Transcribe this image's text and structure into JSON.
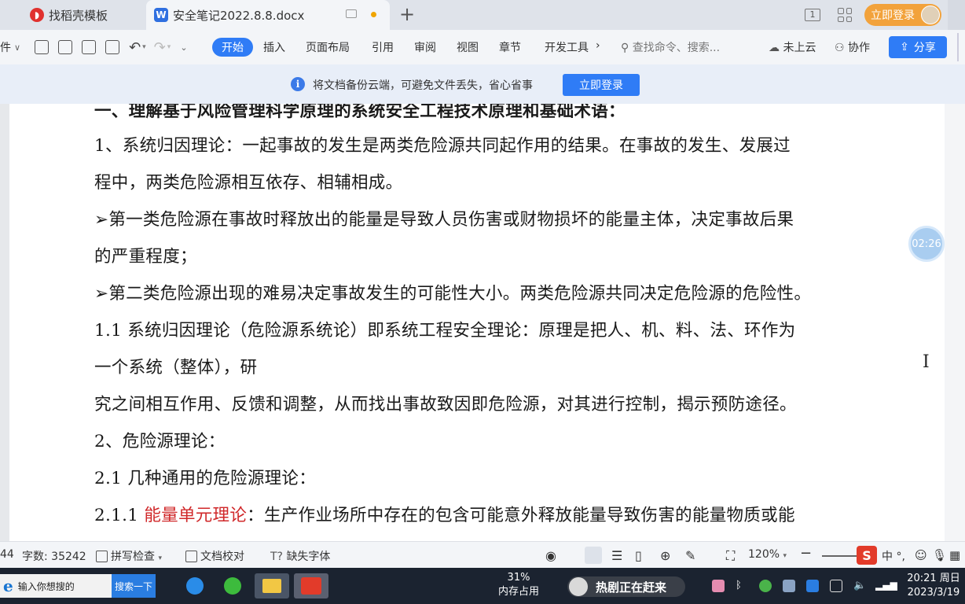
{
  "tabs": {
    "tab1_label": "找稻壳模板",
    "tab2_label": "安全笔记2022.8.8.docx",
    "new_tab": "+"
  },
  "titlebar": {
    "page_indicator": "1",
    "login_label": "立即登录"
  },
  "ribbon": {
    "left_cut_label": "件",
    "menus": [
      "开始",
      "插入",
      "页面布局",
      "引用",
      "审阅",
      "视图",
      "章节",
      "开发工具"
    ],
    "more_arrow": "›",
    "search_placeholder": "查找命令、搜索...",
    "cloud_label": "未上云",
    "cooperate_label": "协作",
    "share_label": "分享"
  },
  "notice": {
    "text": "将文档备份云端，可避免文件丢失，省心省事",
    "button": "立即登录"
  },
  "document": {
    "heading": "一、理解基于风险管理科学原理的系统安全工程技术原理和基础术语：",
    "lines": [
      "1、系统归因理论：一起事故的发生是两类危险源共同起作用的结果。在事故的发生、发展过",
      "程中，两类危险源相互依存、相辅相成。",
      "➢第一类危险源在事故时释放出的能量是导致人员伤害或财物损坏的能量主体，决定事故后果",
      "的严重程度；",
      "➢第二类危险源出现的难易决定事故发生的可能性大小。两类危险源共同决定危险源的危险性。",
      "1.1 系统归因理论（危险源系统论）即系统工程安全理论：原理是把人、机、料、法、环作为",
      "一个系统（整体），研",
      "究之间相互作用、反馈和调整，从而找出事故致因即危险源，对其进行控制，揭示预防途径。",
      "2、危险源理论：",
      "2.1 几种通用的危险源理论："
    ],
    "last_line_prefix": "2.1.1 ",
    "last_line_red": "能量单元理论",
    "last_line_rest": "：生产作业场所中存在的包含可能意外释放能量导致伤害的能量物质或能",
    "accent_red": "#d0282a"
  },
  "timer": "02:26",
  "statusbar": {
    "page_cut": "44",
    "word_count": "字数: 35242",
    "spell_check": "拼写检查",
    "doc_check": "文档校对",
    "missing_font": "缺失字体",
    "zoom": "120%",
    "ime_items": "中 °,"
  },
  "taskbar": {
    "search_placeholder": "输入你想搜的",
    "search_button": "搜索一下",
    "mem_percent": "31%",
    "mem_label": "内存占用",
    "news_label": "热剧正在赶来",
    "time": "20:21 周日",
    "date": "2023/3/19"
  }
}
